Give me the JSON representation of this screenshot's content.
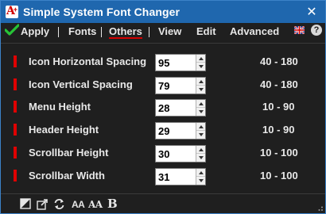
{
  "window": {
    "title": "Simple System Font Changer",
    "close_glyph": "✕"
  },
  "menu": {
    "apply": "Apply",
    "fonts": "Fonts",
    "others": "Others",
    "view": "View",
    "edit": "Edit",
    "advanced": "Advanced",
    "help": "?"
  },
  "rows": [
    {
      "label": "Icon Horizontal Spacing",
      "value": "95",
      "range": "40 - 180"
    },
    {
      "label": "Icon Vertical Spacing",
      "value": "79",
      "range": "40 - 180"
    },
    {
      "label": "Menu Height",
      "value": "28",
      "range": "10 - 90"
    },
    {
      "label": "Header Height",
      "value": "29",
      "range": "10 - 90"
    },
    {
      "label": "Scrollbar Height",
      "value": "30",
      "range": "10 - 100"
    },
    {
      "label": "Scrollbar Width",
      "value": "31",
      "range": "10 - 100"
    }
  ],
  "toolbar": {
    "font_small": "AA",
    "font_serif": "AA",
    "bold": "B"
  },
  "icons": [
    "app-icon",
    "close-icon",
    "checkmark-icon",
    "uk-flag-icon",
    "help-icon",
    "contrast-icon",
    "export-icon",
    "refresh-icon",
    "font-size-icon",
    "font-serif-icon",
    "bold-icon",
    "resize-grip-icon"
  ],
  "colors": {
    "titlebar": "#1f67ae",
    "background": "#1f1f1f",
    "marker_red": "#e00000",
    "check_green": "#27c437"
  }
}
